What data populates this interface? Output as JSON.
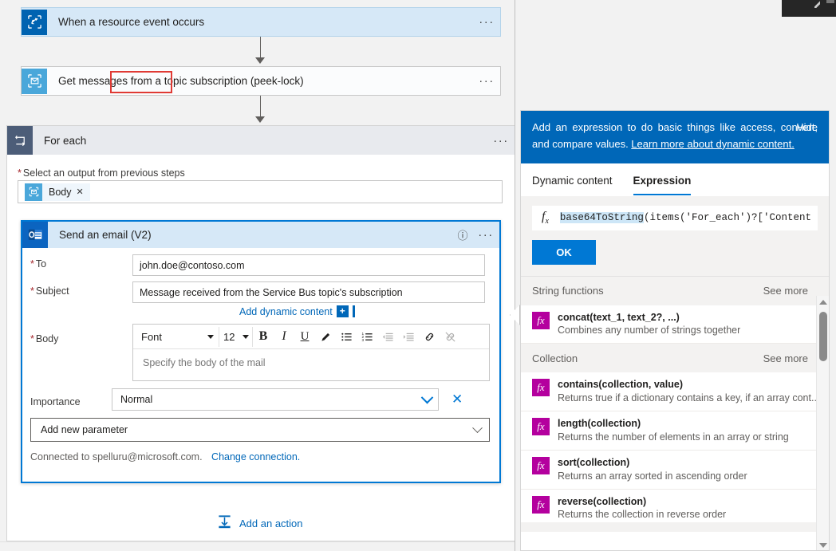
{
  "designer": {
    "trigger": {
      "title": "When a resource event occurs",
      "more": "···",
      "icon": "event-grid-icon"
    },
    "service_bus": {
      "title": "Get messages from a topic subscription (peek-lock)",
      "more": "···",
      "icon": "service-bus-icon"
    },
    "foreach": {
      "title": "For each",
      "more": "···",
      "field_label": "Select an output from previous steps",
      "required_mark": "*",
      "token": {
        "label": "Body",
        "remove": "✕"
      }
    },
    "email": {
      "title": "Send an email (V2)",
      "info": "ⓘ",
      "more": "···",
      "fields": {
        "to_label": "To",
        "to_value": "john.doe@contoso.com",
        "subject_label": "Subject",
        "subject_value": "Message received from the Service Bus topic's subscription",
        "body_label": "Body",
        "body_placeholder": "Specify the body of the mail",
        "importance_label": "Importance",
        "importance_value": "Normal"
      },
      "add_dynamic_content": "Add dynamic content",
      "add_dynamic_plus": "+",
      "rte": {
        "font_label": "Font",
        "size_label": "12",
        "bold": "B",
        "italic": "I",
        "underline": "U",
        "highlight": "✎",
        "bullet_list": "☰",
        "numbered_list": "☰",
        "indent_decrease": "≡",
        "indent_increase": "≡",
        "link": "⚭",
        "unlink": "⚭"
      },
      "add_new_parameter": "Add new parameter",
      "connected_text": "Connected to spelluru@microsoft.com.",
      "change_connection": "Change connection."
    },
    "add_action": "Add an action"
  },
  "expression_panel": {
    "banner_text_1": "Add an expression to do basic things like access, convert, and compare values. ",
    "banner_link": "Learn more about dynamic content.",
    "hide": "Hide",
    "tabs": [
      {
        "label": "Dynamic content",
        "active": false
      },
      {
        "label": "Expression",
        "active": true
      }
    ],
    "fx_symbol": "f",
    "fx_sub": "x",
    "expression_selected": "base64ToString",
    "expression_rest": "(items('For_each')?['Content",
    "ok_label": "OK",
    "groups": [
      {
        "title": "String functions",
        "see_more": "See more",
        "functions": [
          {
            "name": "concat(text_1, text_2?, ...)",
            "desc": "Combines any number of strings together"
          }
        ]
      },
      {
        "title": "Collection",
        "see_more": "See more",
        "functions": [
          {
            "name": "contains(collection, value)",
            "desc": "Returns true if a dictionary contains a key, if an array cont..."
          },
          {
            "name": "length(collection)",
            "desc": "Returns the number of elements in an array or string"
          },
          {
            "name": "sort(collection)",
            "desc": "Returns an array sorted in ascending order"
          },
          {
            "name": "reverse(collection)",
            "desc": "Returns the collection in reverse order"
          }
        ]
      }
    ]
  },
  "colors": {
    "accent_blue": "#0078d4",
    "link_blue": "#0067b8",
    "banner_blue": "#0067b8",
    "highlight_red": "#e03a34",
    "fx_magenta": "#b4009e",
    "required_red": "#a4262c"
  }
}
